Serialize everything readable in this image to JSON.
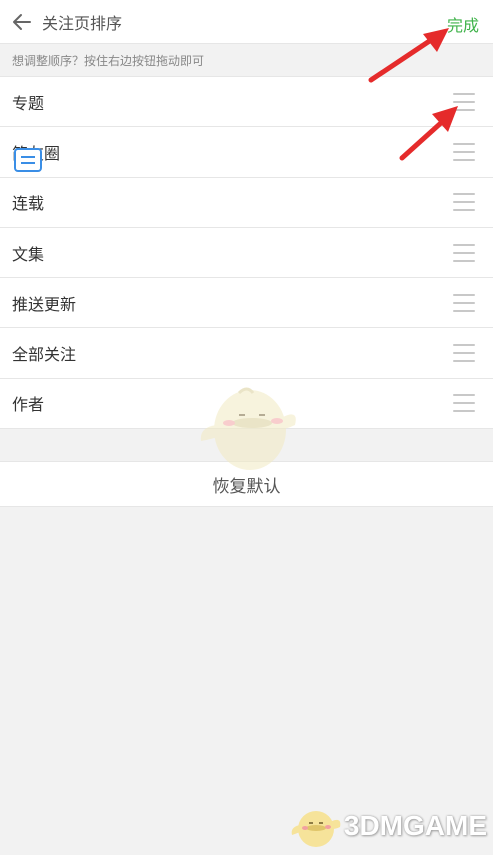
{
  "header": {
    "title": "关注页排序",
    "done_label": "完成",
    "back_icon": "arrow-left-icon"
  },
  "hint": "想调整顺序？按住右边按钮拖动即可",
  "items": [
    {
      "label": "专题"
    },
    {
      "label": "简友圈"
    },
    {
      "label": "连载"
    },
    {
      "label": "文集"
    },
    {
      "label": "推送更新"
    },
    {
      "label": "全部关注"
    },
    {
      "label": "作者"
    }
  ],
  "reset_label": "恢复默认",
  "watermark": "3DMGAME",
  "colors": {
    "accent_green": "#3fb34a",
    "annotation_red": "#e52b2b",
    "background": "#f2f2f2"
  }
}
